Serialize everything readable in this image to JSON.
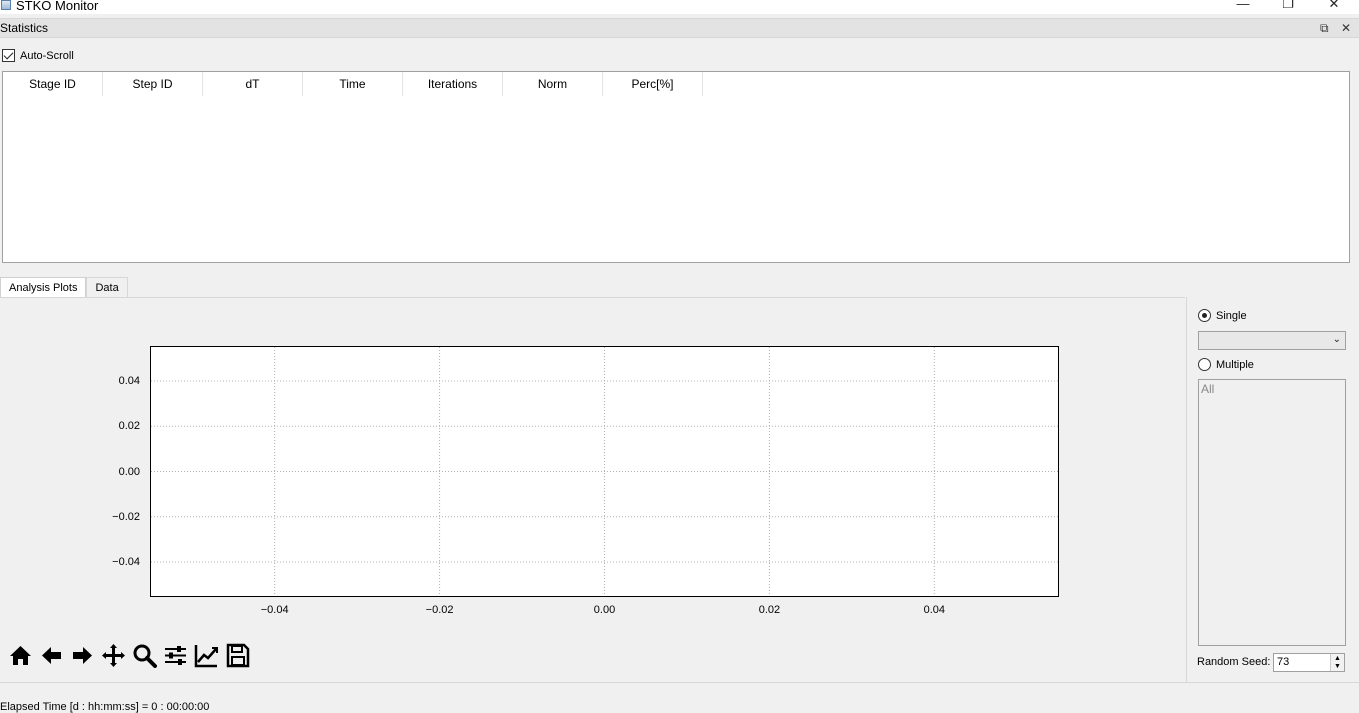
{
  "window": {
    "title": "STKO Monitor",
    "buttons": {
      "minimize": "—",
      "restore": "❐",
      "close": "✕"
    }
  },
  "dock": {
    "title": "Statistics",
    "float_button": "⧉",
    "close_button": "✕"
  },
  "auto_scroll": {
    "label": "Auto-Scroll",
    "checked": true
  },
  "table": {
    "columns": [
      "Stage ID",
      "Step ID",
      "dT",
      "Time",
      "Iterations",
      "Norm",
      "Perc[%]"
    ],
    "rows": []
  },
  "tabs": [
    "Analysis Plots",
    "Data"
  ],
  "chart_data": {
    "type": "line",
    "series": [],
    "xlim": [
      -0.055,
      0.055
    ],
    "ylim": [
      -0.055,
      0.055
    ],
    "x_ticks": [
      "−0.04",
      "−0.02",
      "0.00",
      "0.02",
      "0.04"
    ],
    "y_ticks": [
      "0.04",
      "0.02",
      "0.00",
      "−0.02",
      "−0.04"
    ],
    "grid": true,
    "grid_style": "dotted",
    "title": "",
    "xlabel": "",
    "ylabel": ""
  },
  "right_panel": {
    "single_label": "Single",
    "single_selected": true,
    "dropdown_value": "",
    "multiple_label": "Multiple",
    "list_items": [
      "All"
    ],
    "random_seed_label": "Random Seed:",
    "random_seed_value": "73"
  },
  "toolbar": {
    "icons": [
      "home-icon",
      "back-arrow-icon",
      "forward-arrow-icon",
      "pan-icon",
      "zoom-icon",
      "configure-subplots-icon",
      "edit-axis-icon",
      "save-icon"
    ]
  },
  "footer": {
    "elapsed_time": "Elapsed Time [d : hh:mm:ss] = 0 : 00:00:00"
  }
}
